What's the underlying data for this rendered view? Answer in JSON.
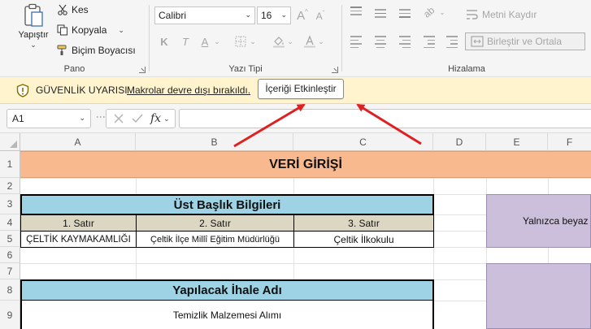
{
  "ribbon": {
    "clipboard": {
      "paste_label": "Yapıştır",
      "cut_label": "Kes",
      "copy_label": "Kopyala",
      "format_painter_label": "Biçim Boyacısı",
      "group_label": "Pano"
    },
    "font": {
      "font_name": "Calibri",
      "font_size": "16",
      "bold": "K",
      "italic": "T",
      "underline": "A",
      "grow": "A",
      "shrink": "A",
      "group_label": "Yazı Tipi"
    },
    "alignment": {
      "wrap_text_label": "Metni Kaydır",
      "merge_label": "Birleştir ve Ortala",
      "group_label": "Hizalama"
    }
  },
  "security_bar": {
    "title": "GÜVENLİK UYARISI",
    "message": "Makrolar devre dışı bırakıldı.",
    "button_label": "İçeriği Etkinleştir"
  },
  "formula_bar": {
    "name_box": "A1",
    "fx_label": "fx",
    "value": ""
  },
  "sheet": {
    "columns": [
      "A",
      "B",
      "C",
      "D",
      "E",
      "F"
    ],
    "rows": [
      "1",
      "2",
      "3",
      "4",
      "5",
      "6",
      "7",
      "8",
      "9"
    ],
    "title": "VERİ GİRİŞİ",
    "header_section_title": "Üst Başlık Bilgileri",
    "line_labels": [
      "1. Satır",
      "2. Satır",
      "3. Satır"
    ],
    "line_values": [
      "ÇELTİK KAYMAKAMLIĞI",
      "Çeltik İlçe Millî Eğitim Müdürlüğü",
      "Çeltik İlkokulu"
    ],
    "tender_section_title": "Yapılacak İhale Adı",
    "tender_name": "Temizlik Malzemesi Alımı",
    "side_note": "Yalnızca beyaz"
  },
  "colors": {
    "title_band": "#f8b98e",
    "section_head": "#9dd3e5",
    "line_label_bg": "#dcd7c2",
    "note_bg": "#cbbfdb",
    "security_bar_bg": "#fff4ce",
    "arrow": "#e02020"
  }
}
